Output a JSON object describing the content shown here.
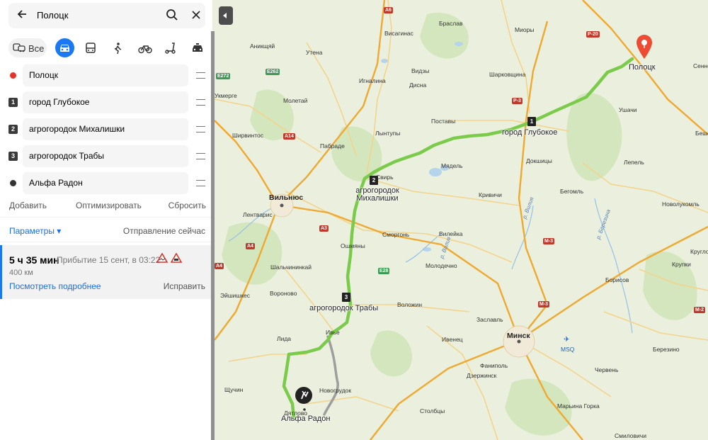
{
  "search": {
    "query": "Полоцк"
  },
  "modes": {
    "all_label": "Все"
  },
  "waypoints": [
    {
      "marker": "",
      "label": "Полоцк",
      "color": "#e5332a"
    },
    {
      "marker": "1",
      "label": "город Глубокое"
    },
    {
      "marker": "2",
      "label": "агрогородок Михалишки"
    },
    {
      "marker": "3",
      "label": "агрогородок Трабы"
    },
    {
      "marker": "",
      "label": "Альфа Радон",
      "color": "#333333"
    }
  ],
  "actions": {
    "add": "Добавить",
    "optimize": "Оптимизировать",
    "reset": "Сбросить"
  },
  "params": {
    "label": "Параметры ▾",
    "departure": "Отправление сейчас"
  },
  "route": {
    "duration": "5 ч 35 мин",
    "arrival": "Прибытие 15 сент, в 03:22",
    "distance": "400 км",
    "details": "Посмотреть подробнее",
    "fix": "Исправить"
  },
  "map": {
    "places": [
      "Браслав",
      "Миоры",
      "Аникщяй",
      "Утена",
      "Висагинас",
      "Видзы",
      "Шарковщина",
      "Игналина",
      "Дисна",
      "Ушачи",
      "Укмерге",
      "Молетай",
      "Поставы",
      "Ширвинтос",
      "Пабраде",
      "Лынтупы",
      "Свирь",
      "Мядель",
      "Докшицы",
      "Лепель",
      "Кривичи",
      "Бегомль",
      "Лентварис",
      "Сморгонь",
      "Вилейка",
      "Ошмяны",
      "Молодечно",
      "Новолукомль",
      "Круглое",
      "Шальчининкай",
      "Крупки",
      "Борисов",
      "Вороново",
      "Воложин",
      "Эйшишкес",
      "Заславль",
      "Ивенец",
      "Лида",
      "Фаниполь",
      "Дзержинск",
      "Березино",
      "Червень",
      "Новогрудок",
      "Щучин",
      "Марьина Горка",
      "Столбцы",
      "Ивье",
      "Сенно",
      "Дятлово",
      "Смиловичи"
    ],
    "big_cities": [
      "Вильнюс",
      "Минск"
    ],
    "airport": "MSQ",
    "rivers": [
      "р. Березина",
      "р. Вилия"
    ],
    "road_shields": [
      "A6",
      "P-20",
      "E272",
      "E262",
      "A14",
      "P-3",
      "A3",
      "A4",
      "E28",
      "M-3",
      "M-3",
      "A4",
      "M-2"
    ],
    "route_labels": [
      "Полоцк",
      "город Глубокое",
      "агрогородок Михалишки",
      "агрогородок Трабы",
      "Альфа Радон"
    ],
    "route_numbers": [
      "1",
      "2",
      "3"
    ],
    "route_color": "#7acb4a",
    "alt_route_color": "#9e9e9e",
    "pin_color": "#ee4b33"
  },
  "partial_labels": [
    "Бешенк..."
  ]
}
